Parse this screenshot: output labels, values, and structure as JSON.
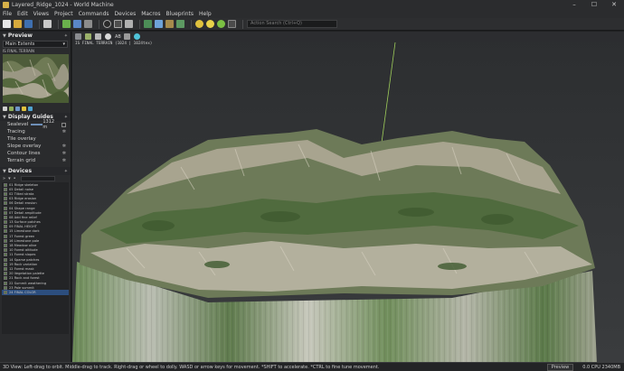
{
  "window": {
    "title": "Layered_Ridge_1024 - World Machine"
  },
  "menu": [
    "File",
    "Edit",
    "Views",
    "Project",
    "Commands",
    "Devices",
    "Macros",
    "Blueprints",
    "Help"
  ],
  "toolbar": {
    "search_placeholder": "Action Search (Ctrl+Q)"
  },
  "preview": {
    "header": "Preview",
    "source": "Main Extents",
    "caption": "IS FINAL TERRAIN"
  },
  "display_guides": {
    "header": "Display Guides",
    "sealevel_label": "Sealevel",
    "sealevel_value": "1312",
    "sealevel_unit": "m",
    "items": [
      "Tracing",
      "Tile overlay",
      "Slope overlay",
      "Contour lines",
      "Terrain grid"
    ]
  },
  "devices": {
    "header": "Devices",
    "items": [
      "01 Ridge skeleton",
      "05 Detail noise",
      "02 Tilted strata",
      "03 Ridge erosion",
      "06 Detail erosion",
      "04 Shape range",
      "07 Detail amplitude",
      "08 Add fine relief",
      "13 Surface patches",
      "09 FINAL HEIGHT",
      "15 Limestone dark",
      "17 Forest green",
      "16 Limestone pale",
      "18 Meadow olive",
      "10 Forest altitude",
      "11 Forest slopes",
      "14 Sparse patches",
      "19 Rock variation",
      "12 Forest mask",
      "20 Vegetation palette",
      "21 Rock and forest",
      "22 Summit weathering",
      "23 Pale summit",
      "24 FINAL COLOR"
    ]
  },
  "viewport": {
    "mode": "AB",
    "caption": "IS FINAL TERRAIN (1024 | 1024tex)"
  },
  "status": {
    "hint": "3D View: Left-drag to orbit. Middle-drag to track. Right-drag or wheel to dolly. WASD or arrow keys for movement. *SHIFT to accelerate. *CTRL to fine tune movement.",
    "preview_button": "Preview",
    "stats": "0.0 CPU 2340MB"
  }
}
